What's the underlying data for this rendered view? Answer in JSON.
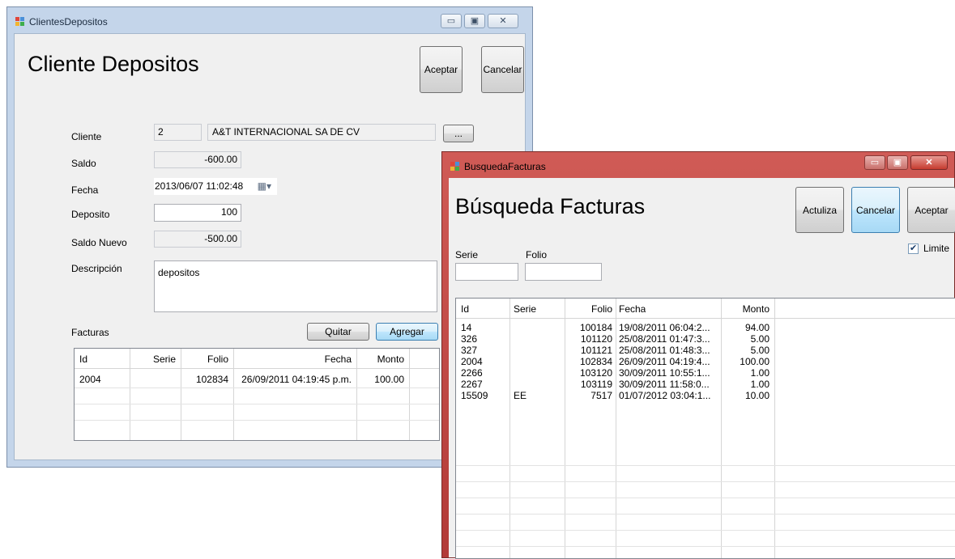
{
  "colors": {
    "accent": "#3c7fb1",
    "w2_frame": "#c8504b"
  },
  "win1": {
    "title": "ClientesDepositos",
    "heading": "Cliente Depositos",
    "buttons": {
      "accept": "Aceptar",
      "cancel": "Cancelar",
      "browse": "...",
      "remove": "Quitar",
      "add": "Agregar"
    },
    "labels": {
      "cliente": "Cliente",
      "saldo": "Saldo",
      "fecha": "Fecha",
      "deposito": "Deposito",
      "saldo_nuevo": "Saldo Nuevo",
      "descripcion": "Descripción",
      "facturas": "Facturas"
    },
    "values": {
      "cliente_id": "2",
      "cliente_name": "A&T INTERNACIONAL SA DE CV",
      "saldo": "-600.00",
      "fecha": "2013/06/07 11:02:48",
      "deposito": "100",
      "saldo_nuevo": "-500.00",
      "descripcion": "depositos"
    },
    "grid": {
      "headers": [
        "Id",
        "Serie",
        "Folio",
        "Fecha",
        "Monto"
      ],
      "rows": [
        [
          "2004",
          "",
          "102834",
          "26/09/2011 04:19:45 p.m.",
          "100.00"
        ]
      ]
    }
  },
  "win2": {
    "title": "BusquedaFacturas",
    "heading": "Búsqueda Facturas",
    "buttons": {
      "refresh": "Actuliza",
      "cancel": "Cancelar",
      "accept": "Aceptar"
    },
    "labels": {
      "serie": "Serie",
      "folio": "Folio",
      "limite": "Limite"
    },
    "limite_checked": true,
    "grid": {
      "headers": [
        "Id",
        "Serie",
        "Folio",
        "Fecha",
        "Monto"
      ],
      "rows": [
        [
          "14",
          "",
          "100184",
          "19/08/2011 06:04:2...",
          "94.00"
        ],
        [
          "326",
          "",
          "101120",
          "25/08/2011 01:47:3...",
          "5.00"
        ],
        [
          "327",
          "",
          "101121",
          "25/08/2011 01:48:3...",
          "5.00"
        ],
        [
          "2004",
          "",
          "102834",
          "26/09/2011 04:19:4...",
          "100.00"
        ],
        [
          "2266",
          "",
          "103120",
          "30/09/2011 10:55:1...",
          "1.00"
        ],
        [
          "2267",
          "",
          "103119",
          "30/09/2011 11:58:0...",
          "1.00"
        ],
        [
          "15509",
          "EE",
          "7517",
          "01/07/2012 03:04:1...",
          "10.00"
        ]
      ]
    }
  }
}
